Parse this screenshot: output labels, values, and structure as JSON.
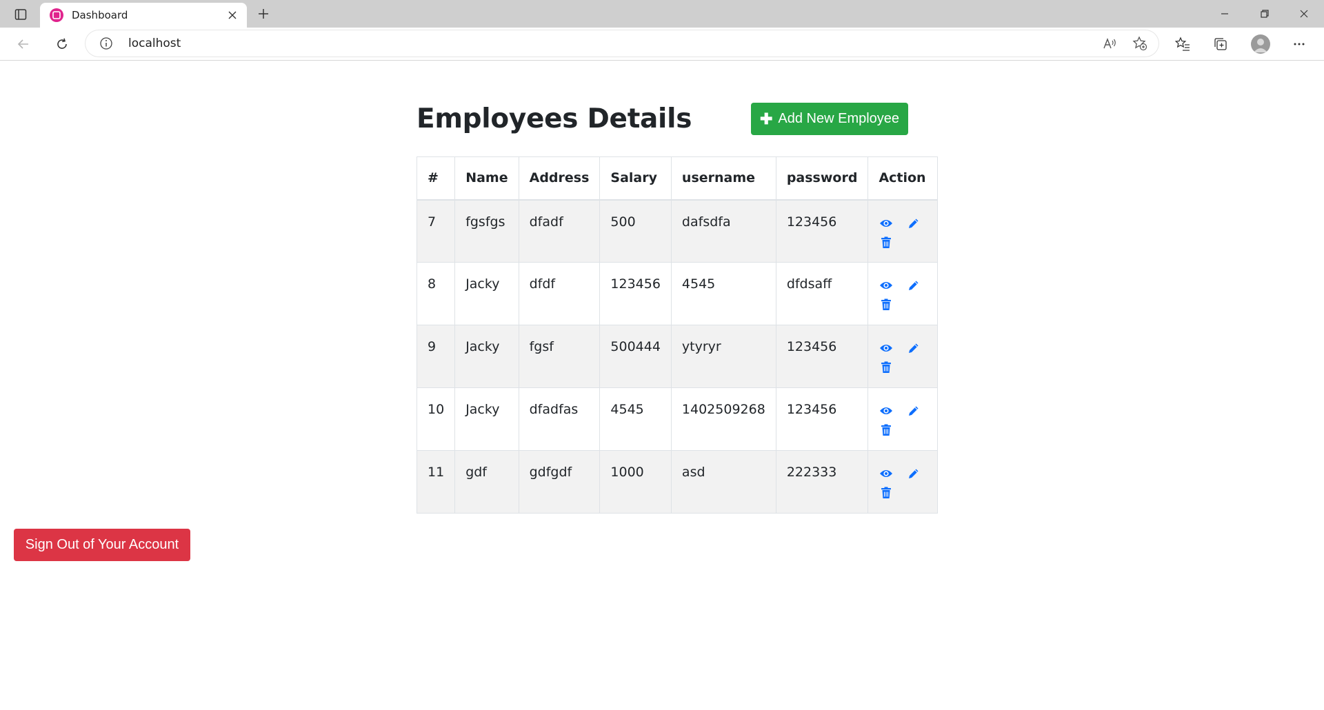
{
  "browser": {
    "tab_title": "Dashboard",
    "url": "localhost"
  },
  "page": {
    "title": "Employees Details",
    "add_button": "Add New Employee",
    "signout_button": "Sign Out of Your Account"
  },
  "table": {
    "headers": [
      "#",
      "Name",
      "Address",
      "Salary",
      "username",
      "password",
      "Action"
    ],
    "rows": [
      {
        "id": "7",
        "name": "fgsfgs",
        "address": "dfadf",
        "salary": "500",
        "username": "dafsdfa",
        "password": "123456"
      },
      {
        "id": "8",
        "name": "Jacky",
        "address": "dfdf",
        "salary": "123456",
        "username": "4545",
        "password": "dfdsaff"
      },
      {
        "id": "9",
        "name": "Jacky",
        "address": "fgsf",
        "salary": "500444",
        "username": "ytyryr",
        "password": "123456"
      },
      {
        "id": "10",
        "name": "Jacky",
        "address": "dfadfas",
        "salary": "4545",
        "username": "1402509268",
        "password": "123456"
      },
      {
        "id": "11",
        "name": "gdf",
        "address": "gdfgdf",
        "salary": "1000",
        "username": "asd",
        "password": "222333"
      }
    ]
  },
  "colors": {
    "add_button": "#28a745",
    "signout_button": "#dc3545",
    "action_icon": "#0d6efd",
    "favicon": "#e0248d"
  },
  "icons": {
    "view": "eye-icon",
    "edit": "pencil-icon",
    "delete": "trash-icon"
  }
}
